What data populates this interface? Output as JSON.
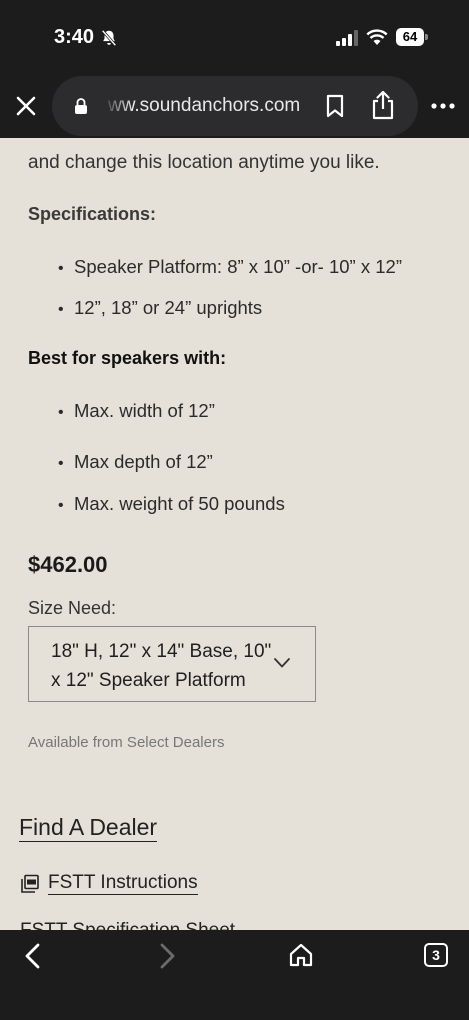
{
  "status": {
    "time": "3:40",
    "battery": "64",
    "icons": [
      "bell-slash-icon",
      "signal-icon",
      "wifi-icon",
      "battery-icon"
    ]
  },
  "browser": {
    "url": "ww.soundanchors.com",
    "icons": [
      "close-icon",
      "lock-icon",
      "bookmark-icon",
      "share-icon",
      "more-icon"
    ]
  },
  "page": {
    "intro": "and change this location anytime you like.",
    "specs_heading": "Specifications:",
    "specs": [
      "Speaker Platform: 8” x 10” -or- 10” x 12”",
      "12”, 18” or 24” uprights"
    ],
    "best_heading": "Best for speakers with:",
    "best": [
      "Max. width of 12”",
      "Max depth of 12”",
      "Max. weight of 50 pounds"
    ],
    "price": "$462.00",
    "size_label": "Size Need:",
    "size_value": "18\" H, 12\" x 14\" Base, 10\" x 12\" Speaker Platform",
    "availability": "Available from Select Dealers",
    "find_dealer": "Find A Dealer",
    "instructions": "FSTT Instructions",
    "partial_link": "FSTT Specification Sheet"
  },
  "toolbar": {
    "tab_count": "3",
    "icons": [
      "back-icon",
      "forward-icon",
      "home-icon",
      "tabs-icon"
    ]
  },
  "colors": {
    "page_background": "#e5e1d8",
    "chrome_background": "#1c1c1c",
    "url_pill": "#2c2c2e"
  }
}
